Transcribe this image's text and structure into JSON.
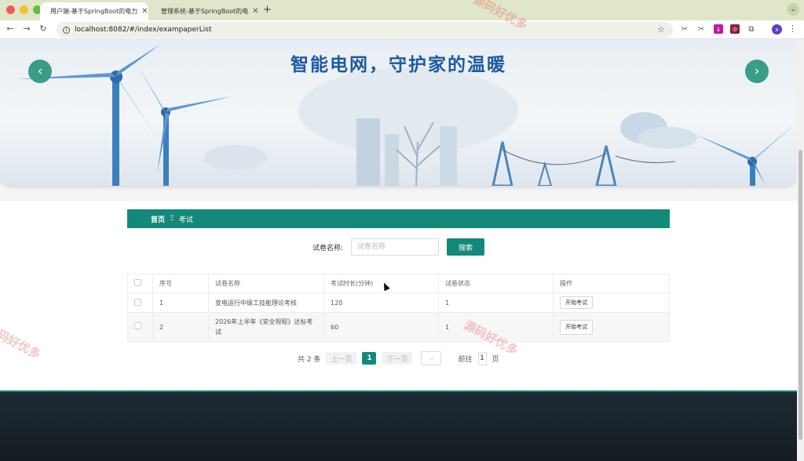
{
  "browser": {
    "tabs": [
      {
        "title": "用户端-基于SpringBoot的电力",
        "active": true
      },
      {
        "title": "管理系统-基于SpringBoot的电",
        "active": false
      }
    ],
    "url": "localhost:8082/#/index/exampaperList",
    "profile_initial": "x"
  },
  "banner": {
    "slogan": "智能电网，守护家的温暖",
    "prev_icon": "‹",
    "next_icon": "›"
  },
  "breadcrumb": {
    "home": "首页",
    "separator": "Ξ",
    "current": "考试"
  },
  "search": {
    "label": "试卷名称:",
    "placeholder": "试卷名称",
    "button": "搜索"
  },
  "table": {
    "headers": [
      "序号",
      "试卷名称",
      "考试时长(分钟)",
      "试卷状态",
      "操作"
    ],
    "rows": [
      {
        "index": "1",
        "name": "变电运行中级工技能理论考核",
        "duration": "120",
        "status": "1",
        "action": "开始考试"
      },
      {
        "index": "2",
        "name": "2026年上半年《安全规程》达标考试",
        "duration": "60",
        "status": "1",
        "action": "开始考试"
      }
    ]
  },
  "pagination": {
    "total": "共 2 条",
    "prev": "上一页",
    "current": "1",
    "next": "下一页",
    "goto_label": "前往",
    "goto_value": "1",
    "page_suffix": "页"
  },
  "watermark": "源码好优多",
  "colors": {
    "accent": "#13897a",
    "footer": "#1d2a33"
  }
}
